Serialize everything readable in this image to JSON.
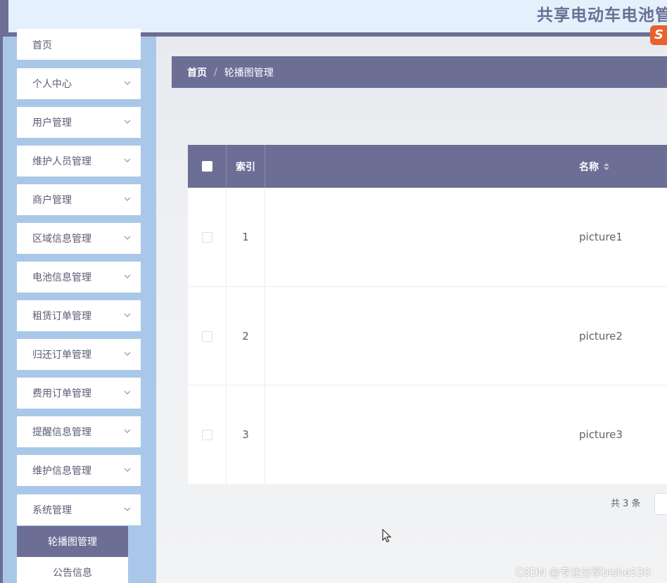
{
  "header": {
    "title": "共享电动车电池管",
    "logo_text": "S"
  },
  "sidebar": {
    "items": [
      {
        "label": "首页"
      },
      {
        "label": "个人中心"
      },
      {
        "label": "用户管理"
      },
      {
        "label": "维护人员管理"
      },
      {
        "label": "商户管理"
      },
      {
        "label": "区域信息管理"
      },
      {
        "label": "电池信息管理"
      },
      {
        "label": "租赁订单管理"
      },
      {
        "label": "归还订单管理"
      },
      {
        "label": "费用订单管理"
      },
      {
        "label": "提醒信息管理"
      },
      {
        "label": "维护信息管理"
      },
      {
        "label": "系统管理"
      }
    ],
    "submenu": [
      {
        "label": "轮播图管理"
      },
      {
        "label": "公告信息"
      }
    ]
  },
  "breadcrumb": {
    "home": "首页",
    "separator": "/",
    "current": "轮播图管理"
  },
  "table": {
    "columns": {
      "index": "索引",
      "name": "名称"
    },
    "rows": [
      {
        "index": "1",
        "name": "picture1"
      },
      {
        "index": "2",
        "name": "picture2"
      },
      {
        "index": "3",
        "name": "picture3"
      }
    ]
  },
  "pagination": {
    "total": "共 3 条"
  },
  "watermark": "CSDN @专注分享bishe530",
  "colors": {
    "primary": "#6c6e96",
    "sidebar_bg": "#a9c8e9",
    "header_bg": "#e4f1fc"
  }
}
